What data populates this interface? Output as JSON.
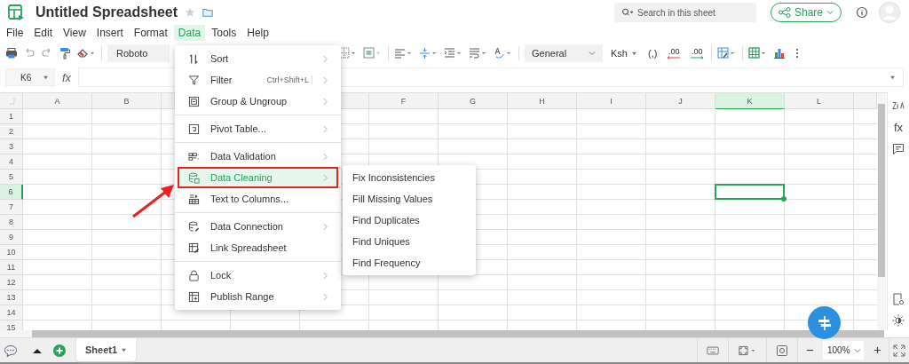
{
  "app": {
    "title": "Untitled Spreadsheet",
    "starred": false
  },
  "search": {
    "placeholder": "Search in this sheet"
  },
  "share_button": {
    "label": "Share"
  },
  "menu_bar": [
    {
      "label": "File",
      "selected": false
    },
    {
      "label": "Edit",
      "selected": false
    },
    {
      "label": "View",
      "selected": false
    },
    {
      "label": "Insert",
      "selected": false
    },
    {
      "label": "Format",
      "selected": false
    },
    {
      "label": "Data",
      "selected": true
    },
    {
      "label": "Tools",
      "selected": false
    },
    {
      "label": "Help",
      "selected": false
    }
  ],
  "toolbar": {
    "font": "Roboto",
    "number_format": "General",
    "currency": "Ksh",
    "comma_style": "(,)",
    "decimal_buttons": [
      ".00",
      ".00"
    ]
  },
  "formula_bar": {
    "cell_ref": "K6",
    "fx_symbol": "fx"
  },
  "sheet": {
    "columns": [
      {
        "label": "A",
        "selected": false
      },
      {
        "label": "B",
        "selected": false
      },
      {
        "label": "F",
        "selected": false
      },
      {
        "label": "G",
        "selected": false
      },
      {
        "label": "H",
        "selected": false
      },
      {
        "label": "I",
        "selected": false
      },
      {
        "label": "J",
        "selected": false
      },
      {
        "label": "K",
        "selected": true
      },
      {
        "label": "L",
        "selected": false
      }
    ],
    "rows": [
      {
        "label": "1",
        "selected": false
      },
      {
        "label": "2",
        "selected": false
      },
      {
        "label": "3",
        "selected": false
      },
      {
        "label": "4",
        "selected": false
      },
      {
        "label": "5",
        "selected": false
      },
      {
        "label": "6",
        "selected": true
      },
      {
        "label": "7",
        "selected": false
      },
      {
        "label": "8",
        "selected": false
      },
      {
        "label": "9",
        "selected": false
      },
      {
        "label": "10",
        "selected": false
      },
      {
        "label": "11",
        "selected": false
      },
      {
        "label": "12",
        "selected": false
      },
      {
        "label": "13",
        "selected": false
      },
      {
        "label": "14",
        "selected": false
      },
      {
        "label": "15",
        "selected": false
      }
    ]
  },
  "data_menu": {
    "groups": [
      [
        {
          "label": "Sort",
          "has_submenu": true,
          "selected": false,
          "callout": false
        },
        {
          "label": "Filter",
          "shortcut": "Ctrl+Shift+L",
          "has_submenu": true,
          "selected": false,
          "callout": false
        },
        {
          "label": "Group & Ungroup",
          "has_submenu": true,
          "selected": false,
          "callout": false
        }
      ],
      [
        {
          "label": "Pivot Table...",
          "has_submenu": true,
          "selected": false,
          "callout": false
        }
      ],
      [
        {
          "label": "Data Validation",
          "has_submenu": true,
          "selected": false,
          "callout": false
        },
        {
          "label": "Data Cleaning",
          "has_submenu": true,
          "selected": true,
          "callout": true
        },
        {
          "label": "Text to Columns...",
          "has_submenu": false,
          "selected": false,
          "callout": false
        }
      ],
      [
        {
          "label": "Data Connection",
          "has_submenu": true,
          "selected": false,
          "callout": false
        },
        {
          "label": "Link Spreadsheet",
          "has_submenu": false,
          "selected": false,
          "callout": false
        }
      ],
      [
        {
          "label": "Lock",
          "has_submenu": true,
          "selected": false,
          "callout": false
        },
        {
          "label": "Publish Range",
          "has_submenu": true,
          "selected": false,
          "callout": false
        }
      ]
    ]
  },
  "submenu": {
    "items": [
      "Fix Inconsistencies",
      "Fill Missing Values",
      "Find Duplicates",
      "Find Uniques",
      "Find Frequency"
    ]
  },
  "sheet_tabs": [
    {
      "label": "Sheet1",
      "selected": true
    }
  ],
  "zoom": {
    "value": "100%"
  },
  "sidebar": {
    "fx_symbol": "fx"
  }
}
